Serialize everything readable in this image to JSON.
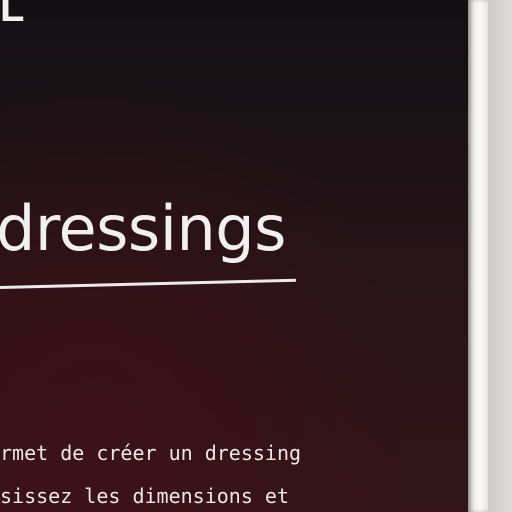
{
  "header": {
    "logo_text": "L"
  },
  "main": {
    "title": "dressings",
    "description_lines": [
      "rmet de créer un dressing",
      "sissez les dimensions et"
    ]
  },
  "colors": {
    "screen_top": "#121013",
    "screen_bottom": "#331519",
    "text": "#f1efef",
    "bezel": "#f2f0ee"
  }
}
